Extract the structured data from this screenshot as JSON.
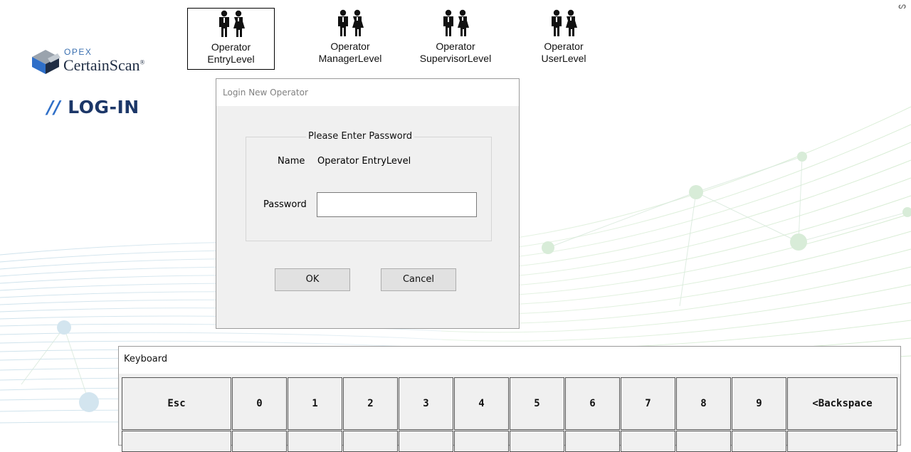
{
  "logo": {
    "brand": "OPEX",
    "product": "CertainScan",
    "trademark": "®"
  },
  "page_heading": {
    "slashes": "//",
    "text": "LOG-IN"
  },
  "corner_mark": "ᔕ",
  "operators": [
    {
      "line1": "Operator",
      "line2": "EntryLevel",
      "selected": true
    },
    {
      "line1": "Operator",
      "line2": "ManagerLevel",
      "selected": false
    },
    {
      "line1": "Operator",
      "line2": "SupervisorLevel",
      "selected": false
    },
    {
      "line1": "Operator",
      "line2": "UserLevel",
      "selected": false
    }
  ],
  "dialog": {
    "title": "Login New Operator",
    "group_title": "Please Enter Password",
    "name_label": "Name",
    "name_value": "Operator EntryLevel",
    "password_label": "Password",
    "password_value": "",
    "ok_label": "OK",
    "cancel_label": "Cancel"
  },
  "keyboard": {
    "title": "Keyboard",
    "keys": [
      "Esc",
      "0",
      "1",
      "2",
      "3",
      "4",
      "5",
      "6",
      "7",
      "8",
      "9",
      "<Backspace"
    ]
  },
  "colors": {
    "accent_blue": "#2f6fc8",
    "heading_navy": "#1c3768",
    "background_mesh_blue": "#bcd7e6",
    "background_mesh_green": "#c8e6c4"
  }
}
